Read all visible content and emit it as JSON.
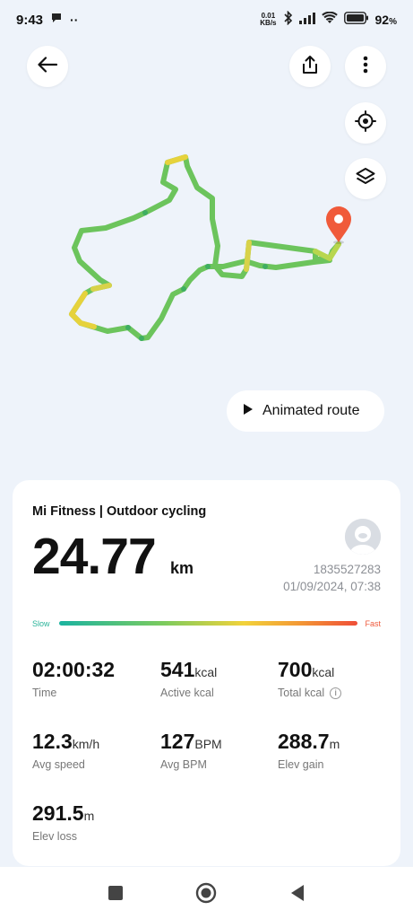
{
  "status": {
    "time": "9:43",
    "net_speed_value": "0.01",
    "net_speed_unit": "KB/s",
    "battery": "92"
  },
  "map": {
    "animated_route_label": "Animated route"
  },
  "workout": {
    "title": "Mi Fitness | Outdoor cycling",
    "distance": "24.77",
    "distance_unit": "km",
    "user_id": "1835527283",
    "date": "01/09/2024, 07:38",
    "speed_slow_label": "Slow",
    "speed_fast_label": "Fast"
  },
  "stats": [
    {
      "value": "02:00:32",
      "unit": "",
      "label": "Time"
    },
    {
      "value": "541",
      "unit": "kcal",
      "label": "Active kcal"
    },
    {
      "value": "700",
      "unit": "kcal",
      "label": "Total kcal"
    },
    {
      "value": "12.3",
      "unit": "km/h",
      "label": "Avg speed"
    },
    {
      "value": "127",
      "unit": "BPM",
      "label": "Avg BPM"
    },
    {
      "value": "288.7",
      "unit": "m",
      "label": "Elev gain"
    },
    {
      "value": "291.5",
      "unit": "m",
      "label": "Elev loss"
    }
  ],
  "colors": {
    "route_green": "#6cc45c",
    "route_yellow": "#e6d23c",
    "pin": "#f05a3a",
    "slow": "#2ab49a",
    "fast": "#ef5a3c"
  },
  "icons": {
    "back": "arrow-left",
    "share": "share",
    "more": "more-vertical",
    "locate": "target",
    "layers": "layers",
    "play": "play"
  }
}
